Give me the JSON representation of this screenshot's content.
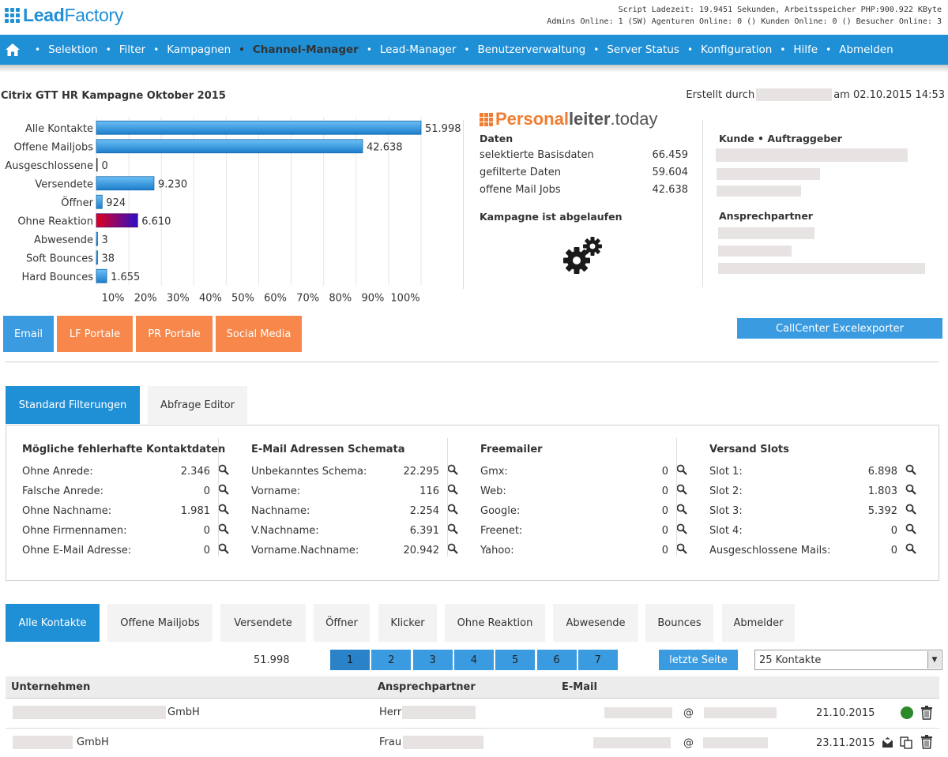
{
  "brand": {
    "logo_bold": "Lead",
    "logo_rest": "Factory",
    "accent": "#1f8fd6"
  },
  "sysinfo": {
    "line1": "Script Ladezeit: 19.9451 Sekunden, Arbeitsspeicher PHP:900.922 KByte",
    "line2": "Admins Online: 1 (SW) Agenturen Online: 0 () Kunden Online: 0 () Besucher Online: 3"
  },
  "nav": {
    "home_icon": "home-icon",
    "items": [
      "Selektion",
      "Filter",
      "Kampagnen",
      "Channel-Manager",
      "Lead-Manager",
      "Benutzerverwaltung",
      "Server Status",
      "Konfiguration",
      "Hilfe",
      "Abmelden"
    ],
    "active": "Channel-Manager"
  },
  "campaign": {
    "title": "Citrix GTT HR Kampagne Oktober 2015",
    "created_prefix": "Erstellt durch",
    "created_suffix": "am 02.10.2015 14:53"
  },
  "chart_data": {
    "type": "bar",
    "orientation": "horizontal",
    "categories": [
      "Alle Kontakte",
      "Offene Mailjobs",
      "Ausgeschlossene",
      "Versendete",
      "Öffner",
      "Ohne Reaktion",
      "Abwesende",
      "Soft Bounces",
      "Hard Bounces"
    ],
    "values": [
      51998,
      42638,
      0,
      9230,
      924,
      6610,
      3,
      38,
      1655
    ],
    "value_labels": [
      "51.998",
      "42.638",
      "0",
      "9.230",
      "924",
      "6.610",
      "3",
      "38",
      "1.655"
    ],
    "xticks": [
      "10%",
      "20%",
      "30%",
      "40%",
      "50%",
      "60%",
      "70%",
      "80%",
      "90%",
      "100%"
    ],
    "xlim": [
      0,
      51998
    ],
    "grid": true,
    "colors": {
      "bar": "#3a9be0",
      "highlight_from": "#e0001b",
      "highlight_to": "#2a10c8"
    }
  },
  "personalleiter": {
    "part_a": "Personal",
    "part_b": "leiter",
    "part_c": ".today",
    "daten_header": "Daten",
    "rows": [
      {
        "label": "selektierte Basisdaten",
        "value": "66.459"
      },
      {
        "label": "gefilterte Daten",
        "value": "59.604"
      },
      {
        "label": "offene Mail Jobs",
        "value": "42.638"
      }
    ],
    "status": "Kampagne ist abgelaufen",
    "gears_icon": "gears-icon"
  },
  "kunde": {
    "header": "Kunde • Auftraggeber",
    "contact_header": "Ansprechpartner"
  },
  "channels": {
    "tabs": [
      "Email",
      "LF Portale",
      "PR Portale",
      "Social Media"
    ],
    "active_color": "#3a9be0",
    "inactive_color": "#f7874a",
    "export_button": "CallCenter Excelexporter"
  },
  "filter_tabs": [
    "Standard Filterungen",
    "Abfrage Editor"
  ],
  "filters": [
    {
      "header": "Mögliche fehlerhafte Kontaktdaten",
      "rows": [
        {
          "label": "Ohne Anrede:",
          "value": "2.346"
        },
        {
          "label": "Falsche Anrede:",
          "value": "0"
        },
        {
          "label": "Ohne Nachname:",
          "value": "1.981"
        },
        {
          "label": "Ohne Firmennamen:",
          "value": "0"
        },
        {
          "label": "Ohne E-Mail Adresse:",
          "value": "0"
        }
      ]
    },
    {
      "header": "E-Mail Adressen Schemata",
      "rows": [
        {
          "label": "Unbekanntes Schema:",
          "value": "22.295"
        },
        {
          "label": "Vorname:",
          "value": "116"
        },
        {
          "label": "Nachname:",
          "value": "2.254"
        },
        {
          "label": "V.Nachname:",
          "value": "6.391"
        },
        {
          "label": "Vorname.Nachname:",
          "value": "20.942"
        }
      ]
    },
    {
      "header": "Freemailer",
      "rows": [
        {
          "label": "Gmx:",
          "value": "0"
        },
        {
          "label": "Web:",
          "value": "0"
        },
        {
          "label": "Google:",
          "value": "0"
        },
        {
          "label": "Freenet:",
          "value": "0"
        },
        {
          "label": "Yahoo:",
          "value": "0"
        }
      ]
    },
    {
      "header": "Versand Slots",
      "rows": [
        {
          "label": "Slot 1:",
          "value": "6.898"
        },
        {
          "label": "Slot 2:",
          "value": "1.803"
        },
        {
          "label": "Slot 3:",
          "value": "5.392"
        },
        {
          "label": "Slot 4:",
          "value": "0"
        },
        {
          "label": "Ausgeschlossene Mails:",
          "value": "0"
        }
      ]
    }
  ],
  "contact_tabs": [
    "Alle Kontakte",
    "Offene Mailjobs",
    "Versendete",
    "Öffner",
    "Klicker",
    "Ohne Reaktion",
    "Abwesende",
    "Bounces",
    "Abmelder"
  ],
  "pagination": {
    "total": "51.998",
    "pages": [
      "1",
      "2",
      "3",
      "4",
      "5",
      "6",
      "7"
    ],
    "current": "1",
    "last_label": "letzte Seite",
    "per_page": "25 Kontakte"
  },
  "table": {
    "headers": [
      "Unternehmen",
      "Ansprechpartner",
      "E-Mail"
    ],
    "rows": [
      {
        "company_suffix": "GmbH",
        "salutation": "Herr",
        "at": "@",
        "date": "21.10.2015",
        "status_icon": "green-dot-icon"
      },
      {
        "company_suffix": "GmbH",
        "salutation": "Frau",
        "at": "@",
        "date": "23.11.2015",
        "status_icon": "mail-open-icon"
      }
    ]
  }
}
